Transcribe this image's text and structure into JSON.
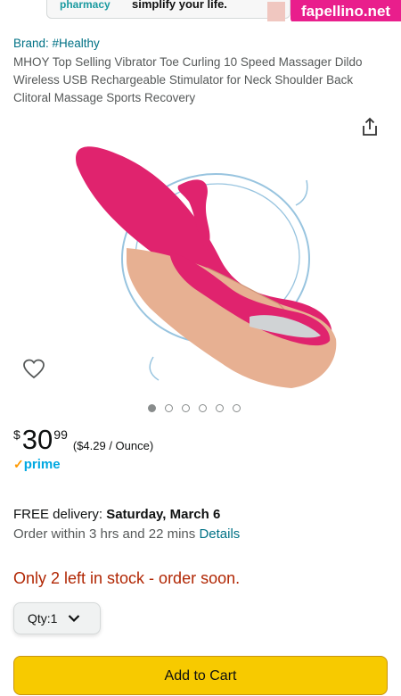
{
  "banner": {
    "left_text": "pharmacy",
    "right_text": "simplify your life."
  },
  "watermark": "fapellino.net",
  "product": {
    "brand": "Brand: #Healthy",
    "title": "MHOY Top Selling Vibrator Toe Curling 10 Speed Massager Dildo Wireless USB Rechargeable Stimulator for Neck Shoulder Back Clitoral Massage Sports Recovery",
    "image_dots": {
      "count": 6,
      "active_index": 0
    }
  },
  "price": {
    "currency": "$",
    "whole": "30",
    "fraction": "99",
    "unit_price": "($4.29 / Ounce)"
  },
  "prime": {
    "check": "✓",
    "label": "prime"
  },
  "delivery": {
    "prefix": "FREE delivery: ",
    "date": "Saturday, March 6",
    "order_within": "Order within 3 hrs and 22 mins ",
    "details_link": "Details"
  },
  "stock": "Only 2 left in stock - order soon.",
  "quantity": {
    "label": "Qty: ",
    "value": "1"
  },
  "buttons": {
    "add_to_cart": "Add to Cart"
  },
  "colors": {
    "link": "#007185",
    "stock": "#b12704",
    "cart": "#f7ca00",
    "product": "#e0236e"
  },
  "icons": {
    "share": "share-icon",
    "wishlist": "heart-icon",
    "chevron": "chevron-down-icon"
  }
}
